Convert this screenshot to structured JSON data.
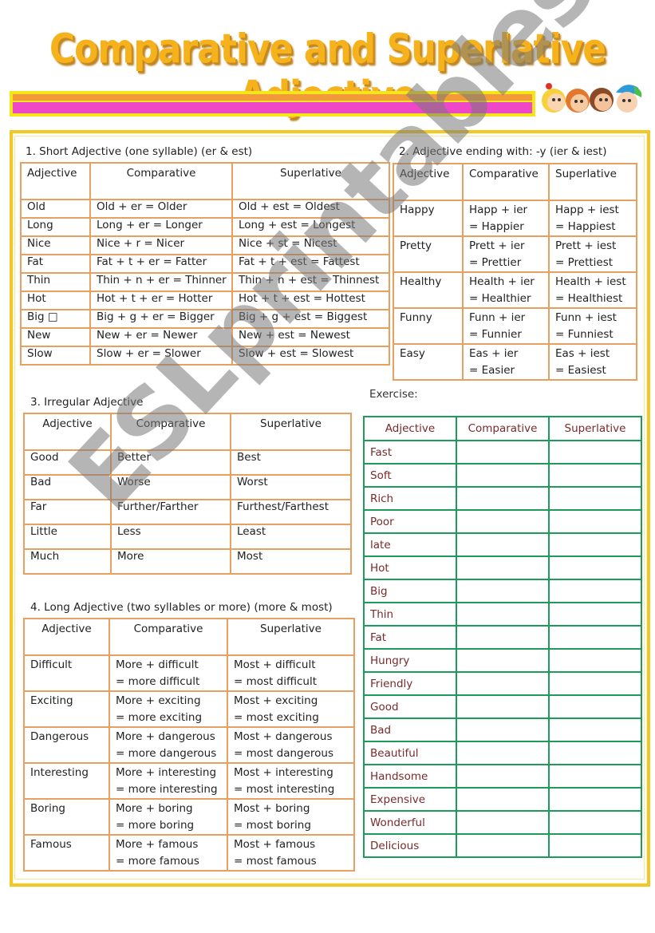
{
  "title": "Comparative and Superlative Adjective",
  "watermark": "ESLprintables.com",
  "colors": {
    "title": "#f6b21c",
    "band_orange": "#f29a3a",
    "band_pink": "#ee48c8",
    "frame": "#f0c82a",
    "table_border": "#e8a060",
    "exercise_border": "#1e9a5a",
    "exercise_text": "#7a2a2a"
  },
  "headers": {
    "adjective": "Adjective",
    "comparative": "Comparative",
    "superlative": "Superlative"
  },
  "section1": {
    "label": "1.  Short Adjective (one syllable) (er & est)",
    "rows": [
      [
        "Old",
        "Old + er = Older",
        "Old + est = Oldest"
      ],
      [
        "Long",
        "Long + er = Longer",
        "Long + est = Longest"
      ],
      [
        "Nice",
        "Nice + r = Nicer",
        "Nice + st = Nicest"
      ],
      [
        "Fat",
        "Fat + t + er = Fatter",
        "Fat + t + est = Fattest"
      ],
      [
        "Thin",
        "Thin + n + er = Thinner",
        "Thin + n + est = Thinnest"
      ],
      [
        "Hot",
        "Hot + t + er = Hotter",
        "Hot + t + est = Hottest"
      ],
      [
        "Big □",
        "Big + g + er = Bigger",
        "Big + g + est = Biggest"
      ],
      [
        "New",
        "New + er = Newer",
        "New + est = Newest"
      ],
      [
        "Slow",
        "Slow + er = Slower",
        "Slow + est = Slowest"
      ]
    ]
  },
  "section2": {
    "label": "2. Adjective ending with: -y (ier & iest)",
    "rows": [
      [
        "Happy",
        "Happ + ier",
        "= Happier",
        "Happ + iest",
        "= Happiest"
      ],
      [
        "Pretty",
        "Prett + ier",
        "= Prettier",
        "Prett + iest",
        "= Prettiest"
      ],
      [
        "Healthy",
        "Health + ier",
        "= Healthier",
        "Health + iest",
        "= Healthiest"
      ],
      [
        "Funny",
        "Funn + ier",
        "= Funnier",
        "Funn + iest",
        "= Funniest"
      ],
      [
        "Easy",
        "Eas + ier",
        "= Easier",
        "Eas + iest",
        "= Easiest"
      ]
    ]
  },
  "section3": {
    "label": "3. Irregular Adjective",
    "rows": [
      [
        "Good",
        "Better",
        "Best"
      ],
      [
        "Bad",
        "Worse",
        "Worst"
      ],
      [
        "Far",
        "Further/Farther",
        "Furthest/Farthest"
      ],
      [
        "Little",
        "Less",
        "Least"
      ],
      [
        "Much",
        "More",
        "Most"
      ]
    ]
  },
  "section4": {
    "label": "4. Long Adjective (two syllables or more) (more & most)",
    "rows": [
      [
        "Difficult",
        "More + difficult",
        "= more difficult",
        "Most + difficult",
        "= most difficult"
      ],
      [
        "Exciting",
        "More + exciting",
        "= more exciting",
        "Most + exciting",
        "= most exciting"
      ],
      [
        "Dangerous",
        "More + dangerous",
        "= more dangerous",
        "Most + dangerous",
        "= most dangerous"
      ],
      [
        "Interesting",
        "More + interesting",
        "= more interesting",
        "Most + interesting",
        "= most interesting"
      ],
      [
        "Boring",
        "More + boring",
        "= more boring",
        "Most + boring",
        "= most boring"
      ],
      [
        "Famous",
        "More + famous",
        "= more famous",
        "Most + famous",
        "= most famous"
      ]
    ]
  },
  "exercise": {
    "label": "Exercise:",
    "words": [
      "Fast",
      "Soft",
      "Rich",
      "Poor",
      "late",
      "Hot",
      "Big",
      "Thin",
      "Fat",
      "Hungry",
      "Friendly",
      "Good",
      "Bad",
      "Beautiful",
      "Handsome",
      "Expensive",
      "Wonderful",
      "Delicious"
    ],
    "comparative_answers": [
      "",
      "",
      "",
      "",
      "",
      "",
      "",
      "",
      "",
      "",
      "",
      "",
      "",
      "",
      "",
      "",
      "",
      ""
    ],
    "superlative_answers": [
      "",
      "",
      "",
      "",
      "",
      "",
      "",
      "",
      "",
      "",
      "",
      "",
      "",
      "",
      "",
      "",
      "",
      ""
    ]
  }
}
